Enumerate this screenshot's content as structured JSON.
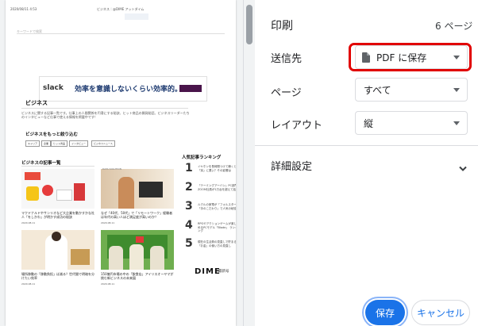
{
  "preview": {
    "header_left": "2020/08/11 4:53",
    "header_center": "ビジネス｜@DIME アットダイム",
    "search_label": "キーワードで検索",
    "ad_brand": "slack",
    "ad_text": "効率を意識しないくらい効率的。",
    "section_business": "ビジネス",
    "business_desc": "ビジネスに関する記事一覧です。仕事上の人間関係を円滑にする秘訣、ヒット商品の開発秘話、ビジネスリーダーたちのインタビューなど仕事で使える情報を掲載中です！",
    "filter_title": "ビジネスをもっと絞り込む",
    "tags": [
      "キャリア",
      "企業",
      "ヒット商品",
      "インタビュー",
      "ビジネスニュース"
    ],
    "articles_title": "ビジネスの記事一覧",
    "articles": [
      {
        "caption": "マクドナルドやサンリオなど大企業を動かすかな社人「をしかわ」が明かす成功の秘訣",
        "date": "2020.08.11",
        "tag": "DATA SOLUTION"
      },
      {
        "caption": "なぜ「40代、50代」で「リモートワーク」経験者は年代の高い人ほど満足度が高いのか？",
        "date": "2020.08.11",
        "tag": ""
      },
      {
        "caption": "場所移動の「移動負担」は減る？世代間で明暗を分けたい効率",
        "date": "2020.08.11",
        "tag": ""
      },
      {
        "caption": "150億円市場の中の「飲食店」アイリスオーヤマが挑む新ビジネスの未来図",
        "date": "2020.08.11",
        "tag": ""
      }
    ],
    "ranking_title": "人気記事ランキング",
    "ranking": [
      {
        "num": "1",
        "text": "イヤホンを長時間つけて聴くと「耳」に悪い？その影響は"
      },
      {
        "num": "2",
        "text": "「テーミングアーバン」PC部門ZOOM社員が1万台を超えて話題"
      },
      {
        "num": "3",
        "text": "ルクルの家電が「フォルスター」「手のこだわり」で人気の秘密"
      },
      {
        "num": "4",
        "text": "RPGやアクションゲームが楽しめるPCモデル「Blade」 ランキング"
      },
      {
        "num": "5",
        "text": "現在の生活費の見直しで貯まる「お金」の使い方の見直し"
      }
    ],
    "dime_logo": "DIME",
    "dime_sub": "最新号"
  },
  "panel": {
    "title": "印刷",
    "page_count": "6 ページ",
    "destination_label": "送信先",
    "destination_value": "PDF に保存",
    "pages_label": "ページ",
    "pages_value": "すべて",
    "layout_label": "レイアウト",
    "layout_value": "縦",
    "more_settings": "詳細設定",
    "save_button": "保存",
    "cancel_button": "キャンセル"
  },
  "colors": {
    "accent": "#1a73e8",
    "highlight": "#e10000"
  }
}
